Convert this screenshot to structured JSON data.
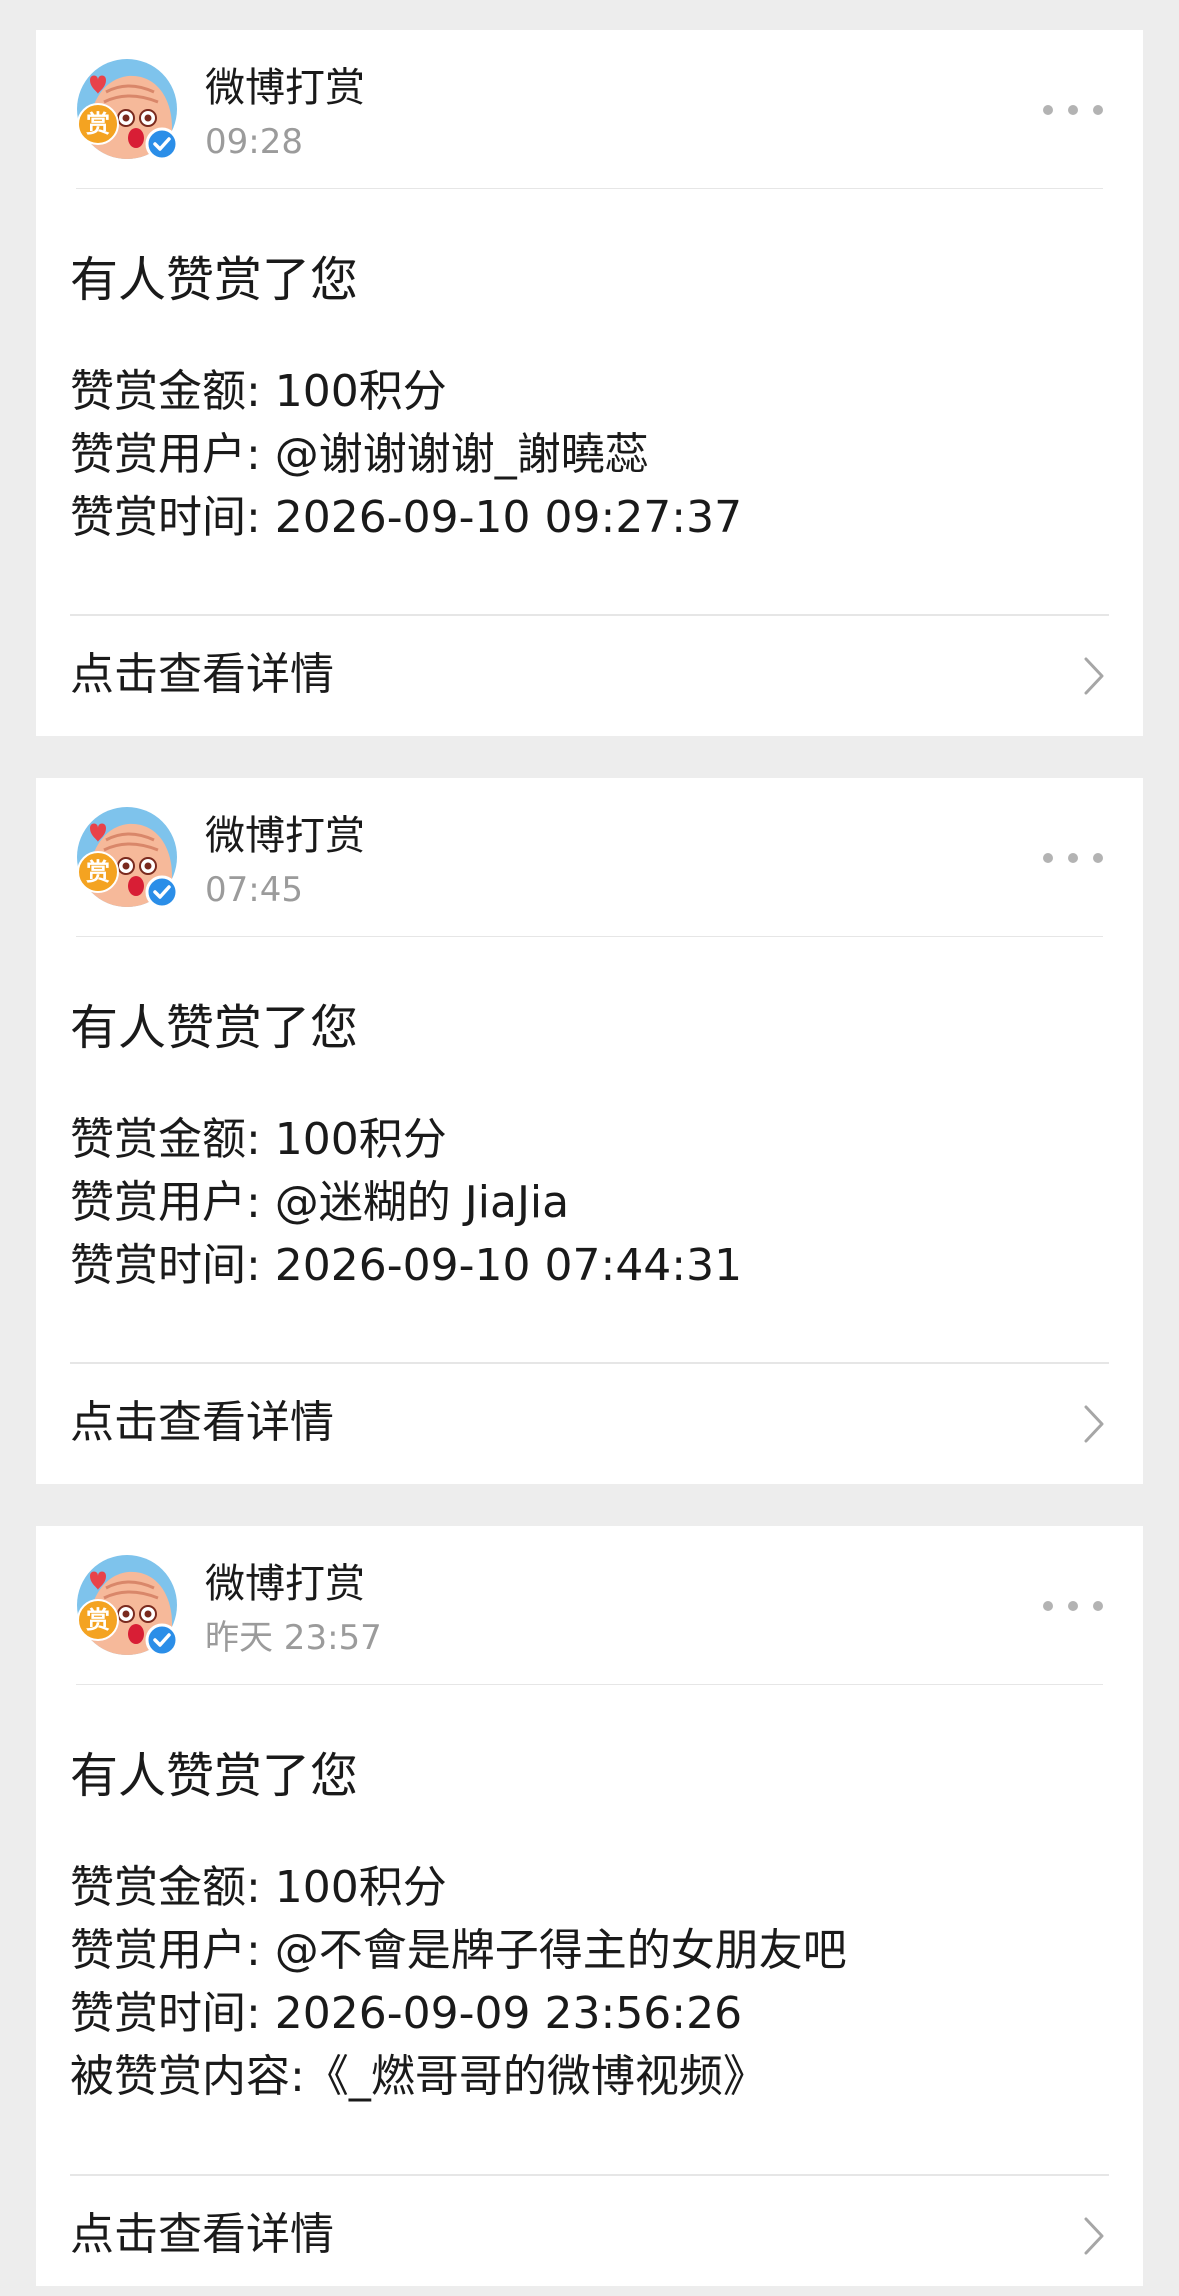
{
  "notifications": [
    {
      "sender": "微博打赏",
      "time": "09:28",
      "headline": "有人赞赏了您",
      "lines": [
        "赞赏金额: 100积分",
        "赞赏用户: @谢谢谢谢_謝曉蕊",
        "赞赏时间: 2026-09-10 09:27:37"
      ],
      "action": "点击查看详情"
    },
    {
      "sender": "微博打赏",
      "time": "07:45",
      "headline": "有人赞赏了您",
      "lines": [
        "赞赏金额: 100积分",
        "赞赏用户: @迷糊的 JiaJia",
        "赞赏时间: 2026-09-10 07:44:31"
      ],
      "action": "点击查看详情"
    },
    {
      "sender": "微博打赏",
      "time": "昨天 23:57",
      "headline": "有人赞赏了您",
      "lines": [
        "赞赏金额: 100积分",
        "赞赏用户: @不會是牌子得主的女朋友吧",
        "赞赏时间: 2026-09-09 23:56:26",
        "被赞赏内容:《_燃哥哥的微博视频》"
      ],
      "action": "点击查看详情"
    }
  ],
  "avatar": {
    "badge_text": "赏",
    "icon": "reward-mascot-avatar",
    "verified_icon": "verified-check-icon",
    "colors": {
      "sky": "#7ec3ec",
      "mascot": "#f6b99a",
      "badge": "#f4a321",
      "verified": "#2b8ee8",
      "heart": "#e8424a"
    }
  },
  "icons": {
    "more": "more-dots-icon",
    "chevron": "chevron-right-icon"
  }
}
